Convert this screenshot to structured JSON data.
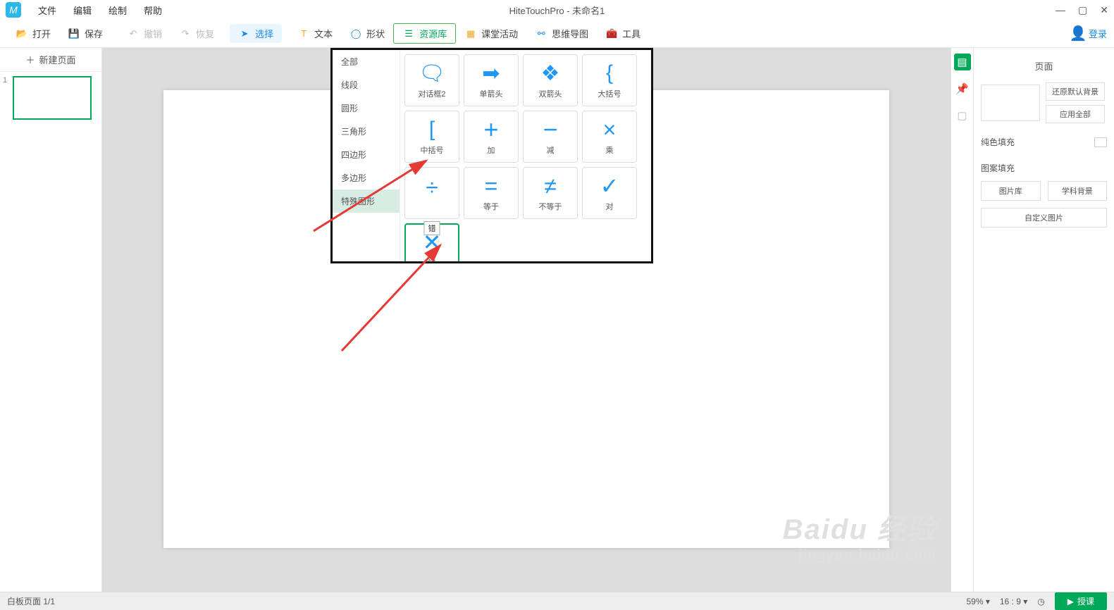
{
  "menubar": {
    "items": [
      "文件",
      "编辑",
      "绘制",
      "帮助"
    ],
    "title": "HiteTouchPro - 未命名1"
  },
  "toolbar": {
    "open": "打开",
    "save": "保存",
    "undo": "撤销",
    "redo": "恢复",
    "select": "选择",
    "text": "文本",
    "shape": "形状",
    "resource": "资源库",
    "activity": "课堂活动",
    "mindmap": "思维导图",
    "tools": "工具",
    "login": "登录"
  },
  "leftpanel": {
    "new_slide": "新建页面",
    "thumb_num": "1"
  },
  "resource_popup": {
    "categories": [
      "全部",
      "线段",
      "圆形",
      "三角形",
      "四边形",
      "多边形",
      "特殊图形"
    ],
    "selected_category_index": 6,
    "shapes_row1": [
      {
        "label": "对话框2",
        "glyph": "speech"
      },
      {
        "label": "单箭头",
        "glyph": "arrow-right"
      },
      {
        "label": "双箭头",
        "glyph": "arrow-both"
      },
      {
        "label": "大括号",
        "glyph": "brace"
      }
    ],
    "shapes_row2": [
      {
        "label": "中括号",
        "glyph": "bracket"
      },
      {
        "label": "加",
        "glyph": "plus"
      },
      {
        "label": "减",
        "glyph": "minus"
      },
      {
        "label": "乘",
        "glyph": "times"
      }
    ],
    "shapes_row3": [
      {
        "label": "",
        "glyph": "divide",
        "tooltip": "错"
      },
      {
        "label": "等于",
        "glyph": "equals"
      },
      {
        "label": "不等于",
        "glyph": "neq"
      },
      {
        "label": "对",
        "glyph": "check"
      }
    ],
    "shapes_row4": [
      {
        "label": "错",
        "glyph": "wrong",
        "selected": true
      }
    ]
  },
  "rightpanel": {
    "title": "页面",
    "restore_bg": "还原默认背景",
    "apply_all": "应用全部",
    "solid_fill": "纯色填充",
    "pattern_fill": "图案填充",
    "img_lib": "图片库",
    "subject_bg": "学科背景",
    "custom_img": "自定义图片"
  },
  "statusbar": {
    "pages": "白板页面 1/1",
    "zoom": "59%",
    "ratio": "16 : 9",
    "teach": "授课"
  },
  "watermark": {
    "line1": "Baidu 经验",
    "line2": "jingyan.baidu.com"
  }
}
